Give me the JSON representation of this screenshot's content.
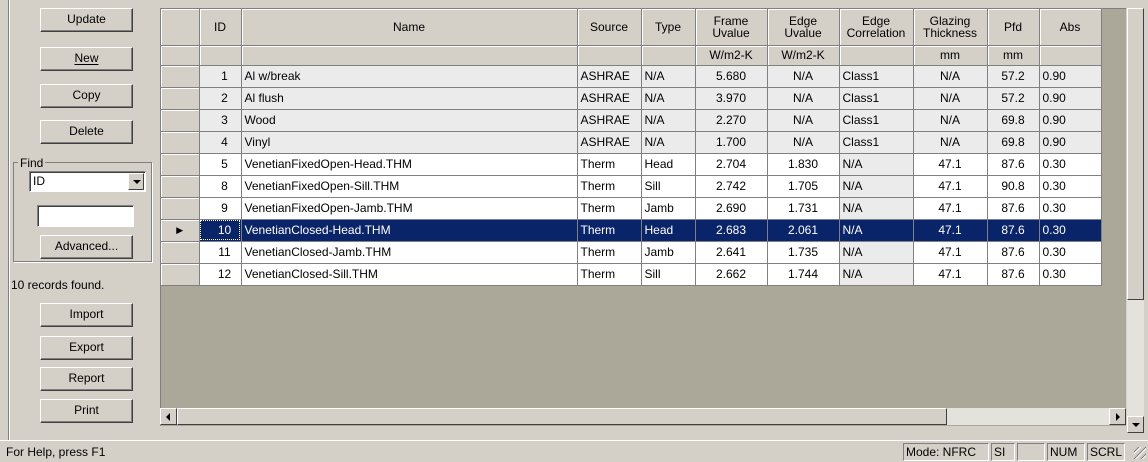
{
  "sidebar": {
    "buttons": {
      "update": "Update",
      "new": "New",
      "copy": "Copy",
      "delete": "Delete",
      "advanced": "Advanced...",
      "import": "Import",
      "export": "Export",
      "report": "Report",
      "print": "Print"
    },
    "find_label": "Find",
    "find_field": "ID",
    "find_value": "",
    "records_found": "10 records found."
  },
  "grid": {
    "headers": [
      "ID",
      "Name",
      "Source",
      "Type",
      "Frame Uvalue",
      "Edge Uvalue",
      "Edge Correlation",
      "Glazing Thickness",
      "Pfd",
      "Abs"
    ],
    "units": [
      "",
      "",
      "",
      "",
      "W/m2-K",
      "W/m2-K",
      "",
      "mm",
      "mm",
      ""
    ],
    "rows": [
      [
        "1",
        "Al w/break",
        "ASHRAE",
        "N/A",
        "5.680",
        "N/A",
        "Class1",
        "N/A",
        "57.2",
        "0.90"
      ],
      [
        "2",
        "Al flush",
        "ASHRAE",
        "N/A",
        "3.970",
        "N/A",
        "Class1",
        "N/A",
        "57.2",
        "0.90"
      ],
      [
        "3",
        "Wood",
        "ASHRAE",
        "N/A",
        "2.270",
        "N/A",
        "Class1",
        "N/A",
        "69.8",
        "0.90"
      ],
      [
        "4",
        "Vinyl",
        "ASHRAE",
        "N/A",
        "1.700",
        "N/A",
        "Class1",
        "N/A",
        "69.8",
        "0.90"
      ],
      [
        "5",
        "VenetianFixedOpen-Head.THM",
        "Therm",
        "Head",
        "2.704",
        "1.830",
        "N/A",
        "47.1",
        "87.6",
        "0.30"
      ],
      [
        "8",
        "VenetianFixedOpen-Sill.THM",
        "Therm",
        "Sill",
        "2.742",
        "1.705",
        "N/A",
        "47.1",
        "90.8",
        "0.30"
      ],
      [
        "9",
        "VenetianFixedOpen-Jamb.THM",
        "Therm",
        "Jamb",
        "2.690",
        "1.731",
        "N/A",
        "47.1",
        "87.6",
        "0.30"
      ],
      [
        "10",
        "VenetianClosed-Head.THM",
        "Therm",
        "Head",
        "2.683",
        "2.061",
        "N/A",
        "47.1",
        "87.6",
        "0.30"
      ],
      [
        "11",
        "VenetianClosed-Jamb.THM",
        "Therm",
        "Jamb",
        "2.641",
        "1.735",
        "N/A",
        "47.1",
        "87.6",
        "0.30"
      ],
      [
        "12",
        "VenetianClosed-Sill.THM",
        "Therm",
        "Sill",
        "2.662",
        "1.744",
        "N/A",
        "47.1",
        "87.6",
        "0.30"
      ]
    ],
    "selected_row_index": 7,
    "current_row_indicator": "▶"
  },
  "statusbar": {
    "help": "For Help, press F1",
    "mode": "Mode: NFRC",
    "units": "SI",
    "num": "NUM",
    "scrl": "SCRL"
  }
}
